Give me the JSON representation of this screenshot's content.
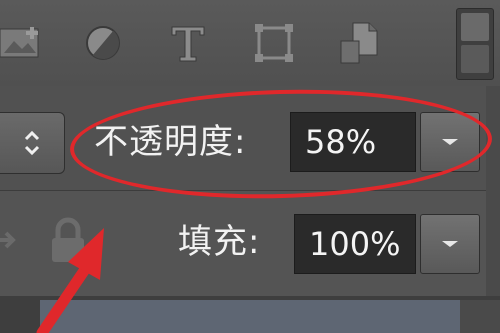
{
  "toolbar": {
    "icons": [
      "image-layer-icon",
      "adjustment-layer-icon",
      "type-layer-icon",
      "shape-layer-icon",
      "smart-object-icon"
    ]
  },
  "opacity": {
    "label": "不透明度:",
    "value": "58%"
  },
  "fill": {
    "label": "填充:",
    "value": "100%"
  },
  "colors": {
    "annotation": "#e0282b",
    "panel": "#535353",
    "field": "#2a2a2a"
  }
}
